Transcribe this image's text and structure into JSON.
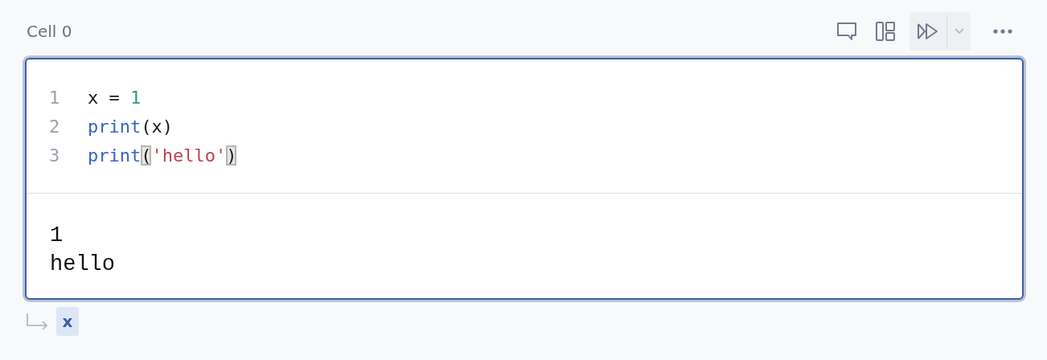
{
  "cell": {
    "title": "Cell 0",
    "code_lines": [
      {
        "number": "1",
        "tokens": [
          {
            "kind": "plain",
            "text": "x = "
          },
          {
            "kind": "number",
            "text": "1"
          }
        ]
      },
      {
        "number": "2",
        "tokens": [
          {
            "kind": "keyword",
            "text": "print"
          },
          {
            "kind": "plain",
            "text": "(x)"
          }
        ]
      },
      {
        "number": "3",
        "tokens": [
          {
            "kind": "keyword",
            "text": "print"
          },
          {
            "kind": "bracket",
            "text": "(",
            "matched": true
          },
          {
            "kind": "string",
            "text": "'hello'"
          },
          {
            "kind": "bracket",
            "text": ")",
            "matched": true
          }
        ]
      }
    ],
    "output_lines": [
      "1",
      "hello"
    ],
    "defined_variables": [
      "x"
    ]
  }
}
